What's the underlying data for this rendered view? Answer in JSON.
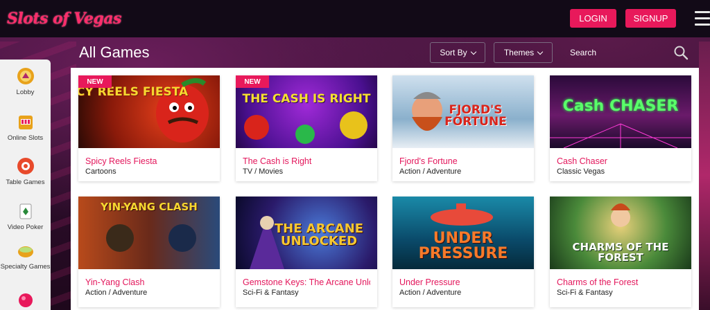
{
  "header": {
    "logo_text": "Slots of Vegas",
    "login_label": "LOGIN",
    "signup_label": "SIGNUP"
  },
  "toolbar": {
    "title": "All Games",
    "sort_label": "Sort By",
    "themes_label": "Themes",
    "search_placeholder": "Search"
  },
  "sidebar": {
    "items": [
      {
        "label": "Lobby",
        "icon": "lobby-icon"
      },
      {
        "label": "Online Slots",
        "icon": "slot-machine-icon"
      },
      {
        "label": "Table Games",
        "icon": "roulette-chip-icon"
      },
      {
        "label": "Video Poker",
        "icon": "playing-card-icon"
      },
      {
        "label": "Specialty Games",
        "icon": "specialty-bowl-icon"
      }
    ]
  },
  "games": [
    {
      "title": "Spicy Reels Fiesta",
      "category": "Cartoons",
      "badge": "NEW",
      "art": "SPICY REELS FIESTA"
    },
    {
      "title": "The Cash is Right",
      "category": "TV / Movies",
      "badge": "NEW",
      "art": "THE CASH IS RIGHT"
    },
    {
      "title": "Fjord's Fortune",
      "category": "Action / Adventure",
      "badge": "",
      "art": "FJORD'S FORTUNE"
    },
    {
      "title": "Cash Chaser",
      "category": "Classic Vegas",
      "badge": "",
      "art": "Cash CHASER"
    },
    {
      "title": "Yin-Yang Clash",
      "category": "Action / Adventure",
      "badge": "",
      "art": "YIN-YANG CLASH"
    },
    {
      "title": "Gemstone Keys: The Arcane Unlocked",
      "category": "Sci-Fi & Fantasy",
      "badge": "",
      "art": "THE ARCANE UNLOCKED"
    },
    {
      "title": "Under Pressure",
      "category": "Action / Adventure",
      "badge": "",
      "art": "UNDER PRESSURE"
    },
    {
      "title": "Charms of the Forest",
      "category": "Sci-Fi & Fantasy",
      "badge": "",
      "art": "CHARMS OF THE FOREST"
    }
  ],
  "colors": {
    "accent": "#e8195b",
    "title_pink": "#e3165b",
    "header_bg": "#120a17"
  }
}
